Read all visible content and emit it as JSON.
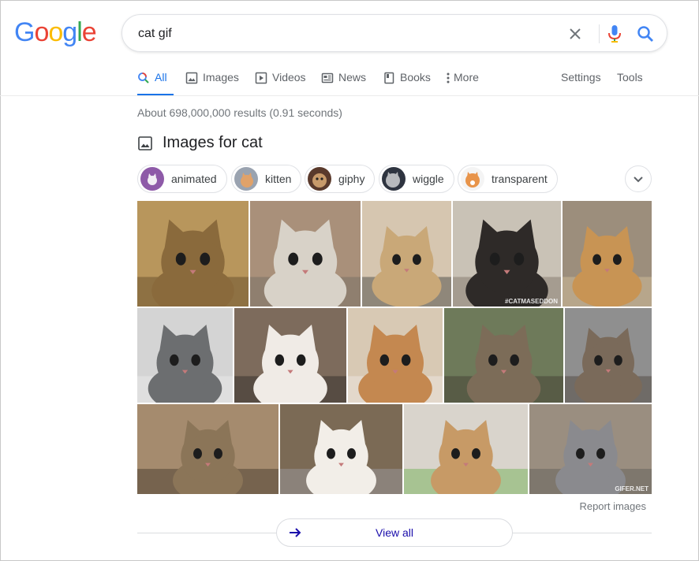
{
  "logo": {
    "letters": [
      {
        "ch": "G",
        "color": "#4285f4"
      },
      {
        "ch": "o",
        "color": "#ea4335"
      },
      {
        "ch": "o",
        "color": "#fbbc05"
      },
      {
        "ch": "g",
        "color": "#4285f4"
      },
      {
        "ch": "l",
        "color": "#34a853"
      },
      {
        "ch": "e",
        "color": "#ea4335"
      }
    ]
  },
  "search": {
    "query": "cat gif",
    "clear_icon": "close-icon",
    "mic_icon": "mic-icon",
    "search_icon": "search-icon"
  },
  "tabs": [
    {
      "label": "All",
      "icon": "search-icon",
      "active": true
    },
    {
      "label": "Images",
      "icon": "image-icon",
      "active": false
    },
    {
      "label": "Videos",
      "icon": "play-icon",
      "active": false
    },
    {
      "label": "News",
      "icon": "news-icon",
      "active": false
    },
    {
      "label": "Books",
      "icon": "book-icon",
      "active": false
    },
    {
      "label": "More",
      "icon": "more-vert-icon",
      "active": false
    }
  ],
  "tools": {
    "settings": "Settings",
    "tools": "Tools"
  },
  "result_stats": "About 698,000,000 results (0.91 seconds)",
  "images_heading": "Images for cat",
  "chips": [
    {
      "label": "animated"
    },
    {
      "label": "kitten"
    },
    {
      "label": "giphy"
    },
    {
      "label": "wiggle"
    },
    {
      "label": "transparent"
    }
  ],
  "tiles": [
    {
      "name": "cat-image-1",
      "bg": "#b8965c",
      "fur": "#8a6a3c",
      "accent": "#5a4426"
    },
    {
      "name": "cat-image-2",
      "bg": "#a9907a",
      "fur": "#d8d2c8",
      "accent": "#6f6a62"
    },
    {
      "name": "cat-image-3",
      "bg": "#d6c6b0",
      "fur": "#c9a878",
      "accent": "#3a3a3a"
    },
    {
      "name": "cat-image-4",
      "bg": "#c9c2b6",
      "fur": "#2e2a28",
      "accent": "#7b6f62",
      "caption": "#CATMASEDDON"
    },
    {
      "name": "cat-image-5",
      "bg": "#9c8e7c",
      "fur": "#c89454",
      "accent": "#d9c49e"
    },
    {
      "name": "cat-image-6",
      "bg": "#d4d4d4",
      "fur": "#6c6e70",
      "accent": "#eeeeee"
    },
    {
      "name": "cat-image-7",
      "bg": "#7d6b5c",
      "fur": "#f0ebe6",
      "accent": "#2b2726"
    },
    {
      "name": "cat-image-8",
      "bg": "#d8c9b4",
      "fur": "#c48850",
      "accent": "#f1ece6"
    },
    {
      "name": "cat-image-9",
      "bg": "#6e7a5a",
      "fur": "#7c6c58",
      "accent": "#3f382e"
    },
    {
      "name": "cat-image-10",
      "bg": "#8f8f8f",
      "fur": "#7a6a5a",
      "accent": "#4a4038"
    },
    {
      "name": "cat-image-11",
      "bg": "#a58b6e",
      "fur": "#8b7558",
      "accent": "#3f3428"
    },
    {
      "name": "cat-image-12",
      "bg": "#7b6a55",
      "fur": "#f2eee8",
      "accent": "#a0a0a8"
    },
    {
      "name": "cat-image-13",
      "bg": "#d9d4cc",
      "fur": "#c79a66",
      "accent": "#6ab04c"
    },
    {
      "name": "cat-image-14",
      "bg": "#9a8e80",
      "fur": "#8a8a8e",
      "accent": "#5e5a56",
      "caption": "GIFER.NET"
    }
  ],
  "report_images": "Report images",
  "view_all": "View all",
  "colors": {
    "accent_blue": "#1a73e8",
    "link_blue": "#1a0dab",
    "muted_gray": "#70757a",
    "border_gray": "#dfe1e5"
  }
}
